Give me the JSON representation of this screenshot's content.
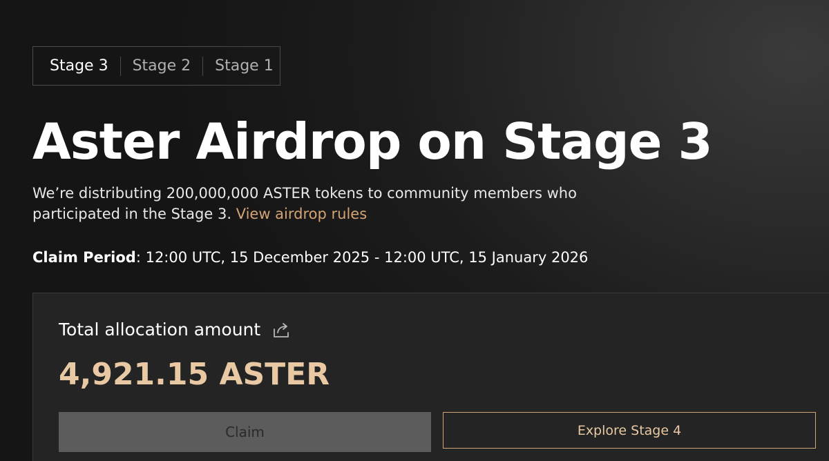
{
  "tabs": [
    {
      "label": "Stage 3",
      "active": true
    },
    {
      "label": "Stage 2",
      "active": false
    },
    {
      "label": "Stage 1",
      "active": false
    }
  ],
  "title": "Aster Airdrop on Stage 3",
  "description": {
    "text": "We’re distributing 200,000,000 ASTER tokens to community members who participated in the Stage 3. ",
    "link_label": "View airdrop rules"
  },
  "claim_period": {
    "label": "Claim Period",
    "value": ": 12:00 UTC, 15 December 2025 - 12:00 UTC, 15 January 2026"
  },
  "allocation": {
    "label": "Total allocation amount",
    "amount": "4,921.15 ASTER",
    "share_icon": "share-icon"
  },
  "buttons": {
    "claim_label": "Claim",
    "explore_label": "Explore Stage 4"
  },
  "colors": {
    "accent": "#d4a574",
    "amount": "#e8c9a4",
    "disabled_button": "#5c5c5c"
  }
}
